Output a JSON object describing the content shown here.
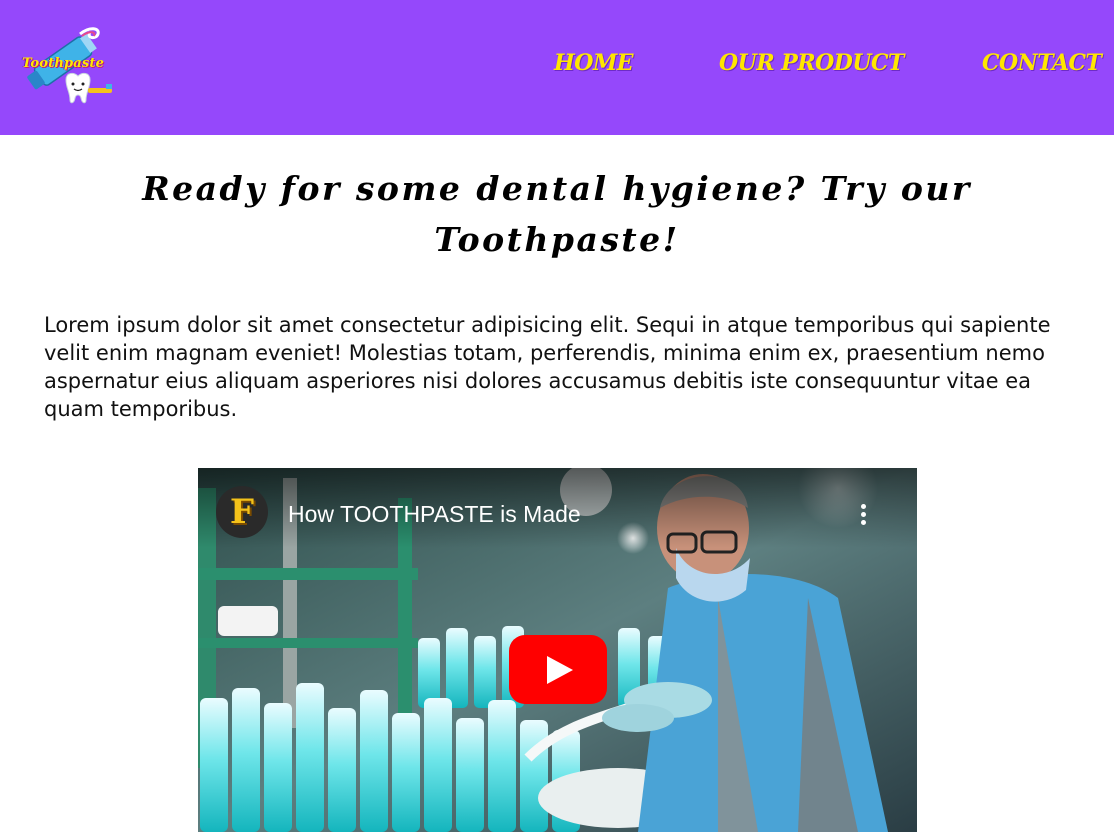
{
  "header": {
    "logo_text": "Toothpaste",
    "nav": [
      {
        "label": "HOME"
      },
      {
        "label": "OUR PRODUCT"
      },
      {
        "label": "CONTACT"
      }
    ]
  },
  "main": {
    "headline": "Ready for some dental hygiene? Try our Toothpaste!",
    "paragraph": "Lorem ipsum dolor sit amet consectetur adipisicing elit. Sequi in atque temporibus qui sapiente velit enim magnam eveniet! Molestias totam, perferendis, minima enim ex, praesentium nemo aspernatur eius aliquam asperiores nisi dolores accusamus debitis iste consequuntur vitae ea quam temporibus.",
    "video": {
      "title": "How TOOTHPASTE is Made",
      "channel_initial": "F",
      "icons": [
        "youtube-play-icon",
        "more-options-icon"
      ],
      "colors": {
        "play_button": "#ff0000"
      }
    }
  },
  "colors": {
    "header_bg": "#9548fb",
    "nav_text": "#ffe600"
  }
}
